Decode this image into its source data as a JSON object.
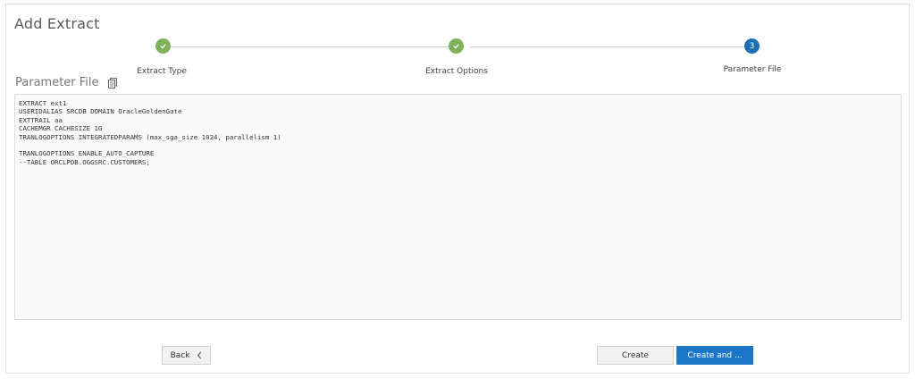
{
  "dialog": {
    "title": "Add Extract"
  },
  "steps": [
    {
      "label": "Extract Type",
      "state": "done"
    },
    {
      "label": "Extract Options",
      "state": "done"
    },
    {
      "label": "Parameter File",
      "state": "active",
      "number": "3"
    }
  ],
  "section": {
    "title": "Parameter File",
    "icon": "copy-icon"
  },
  "parameter_file": {
    "lines": [
      "EXTRACT ext1",
      "USERIDALIAS SRCDB DOMAIN OracleGoldenGate",
      "EXTTRAIL aa",
      "CACHEMGR CACHESIZE 1G",
      "TRANLOGOPTIONS INTEGRATEDPARAMS (max_sga_size 1024, parallelism 1)",
      "",
      "TRANLOGOPTIONS ENABLE_AUTO_CAPTURE",
      "--TABLE ORCLPDB.OGGSRC.CUSTOMERS;"
    ]
  },
  "buttons": {
    "back": "Back",
    "create": "Create",
    "create_and": "Create and ..."
  },
  "colors": {
    "step_done": "#7fb05b",
    "step_active": "#1e6eb4",
    "primary_button": "#1e77c6"
  }
}
